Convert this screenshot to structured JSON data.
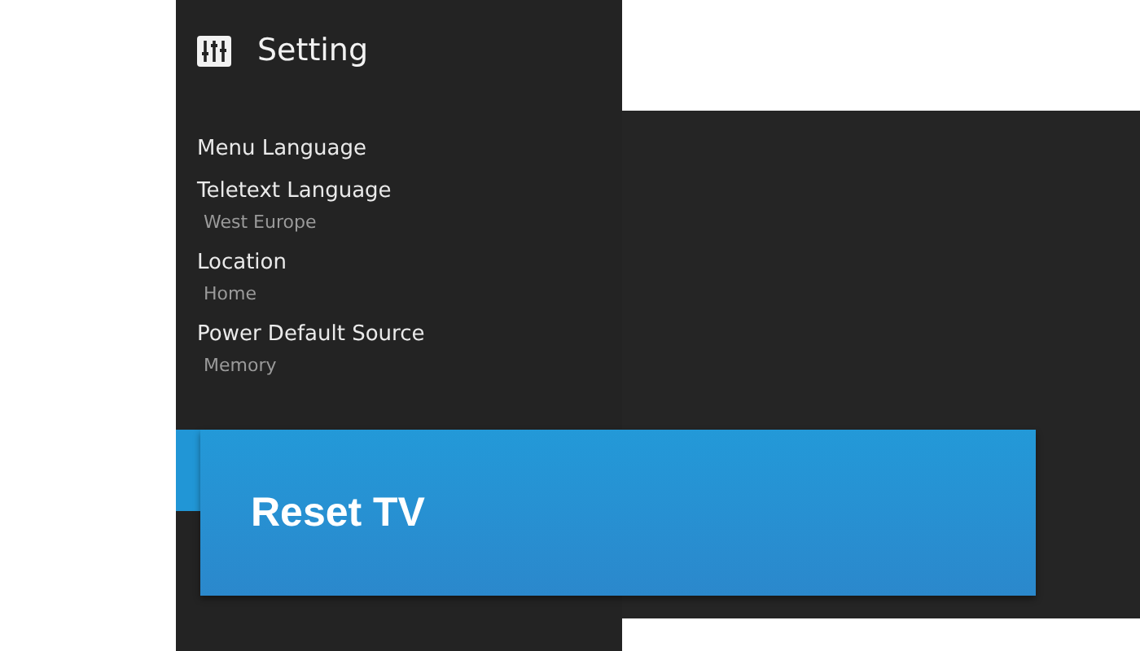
{
  "panel": {
    "title": "Setting"
  },
  "items": [
    {
      "label": "Menu Language",
      "selected": false
    },
    {
      "label": "Teletext Language",
      "value": "West Europe",
      "selected": false
    },
    {
      "label": "Location",
      "value": "Home",
      "selected": false
    },
    {
      "label": "Power Default Source",
      "value": "Memory",
      "selected": false
    },
    {
      "label": "Reset TV",
      "selected": true
    }
  ]
}
